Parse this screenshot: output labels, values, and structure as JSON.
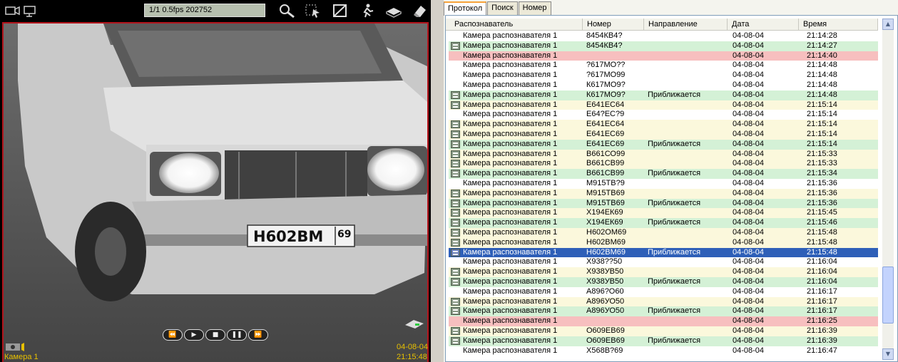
{
  "camera": {
    "stream_info": "1/1 0.5fps 202752",
    "label": "Камера 1",
    "date": "04-08-04",
    "time": "21:15:48",
    "plate_text": "Н602ВМ",
    "plate_region": "69",
    "transport": [
      "⏪",
      "▶",
      "■",
      "❚❚",
      "⏩"
    ]
  },
  "tabs": [
    {
      "label": "Протокол",
      "active": true
    },
    {
      "label": "Поиск",
      "active": false
    },
    {
      "label": "Номер",
      "active": false
    }
  ],
  "columns": [
    "Распознаватель",
    "Номер",
    "Направление",
    "Дата",
    "Время"
  ],
  "rows": [
    {
      "recognizer": "Камера распознавателя 1",
      "number": "8454КВ4?",
      "direction": "",
      "date": "04-08-04",
      "time": "21:14:28",
      "style": "white",
      "icon": false
    },
    {
      "recognizer": "Камера распознавателя 1",
      "number": "8454КВ4?",
      "direction": "",
      "date": "04-08-04",
      "time": "21:14:27",
      "style": "green",
      "icon": true
    },
    {
      "recognizer": "Камера распознавателя 1",
      "number": "",
      "direction": "",
      "date": "04-08-04",
      "time": "21:14:40",
      "style": "red",
      "icon": false
    },
    {
      "recognizer": "Камера распознавателя 1",
      "number": "?617МО??",
      "direction": "",
      "date": "04-08-04",
      "time": "21:14:48",
      "style": "white",
      "icon": false
    },
    {
      "recognizer": "Камера распознавателя 1",
      "number": "?617МО99",
      "direction": "",
      "date": "04-08-04",
      "time": "21:14:48",
      "style": "white",
      "icon": false
    },
    {
      "recognizer": "Камера распознавателя 1",
      "number": "К617МО9?",
      "direction": "",
      "date": "04-08-04",
      "time": "21:14:48",
      "style": "white",
      "icon": false
    },
    {
      "recognizer": "Камера распознавателя 1",
      "number": "К617МО9?",
      "direction": "Приближается",
      "date": "04-08-04",
      "time": "21:14:48",
      "style": "green",
      "icon": true
    },
    {
      "recognizer": "Камера распознавателя 1",
      "number": "Е641ЕС64",
      "direction": "",
      "date": "04-08-04",
      "time": "21:15:14",
      "style": "yellow",
      "icon": true
    },
    {
      "recognizer": "Камера распознавателя 1",
      "number": "Е64?ЕС?9",
      "direction": "",
      "date": "04-08-04",
      "time": "21:15:14",
      "style": "white",
      "icon": false
    },
    {
      "recognizer": "Камера распознавателя 1",
      "number": "Е641ЕС64",
      "direction": "",
      "date": "04-08-04",
      "time": "21:15:14",
      "style": "yellow",
      "icon": true
    },
    {
      "recognizer": "Камера распознавателя 1",
      "number": "Е641ЕС69",
      "direction": "",
      "date": "04-08-04",
      "time": "21:15:14",
      "style": "yellow",
      "icon": true
    },
    {
      "recognizer": "Камера распознавателя 1",
      "number": "Е641ЕС69",
      "direction": "Приближается",
      "date": "04-08-04",
      "time": "21:15:14",
      "style": "green",
      "icon": true
    },
    {
      "recognizer": "Камера распознавателя 1",
      "number": "В661СО99",
      "direction": "",
      "date": "04-08-04",
      "time": "21:15:33",
      "style": "yellow",
      "icon": true
    },
    {
      "recognizer": "Камера распознавателя 1",
      "number": "В661СВ99",
      "direction": "",
      "date": "04-08-04",
      "time": "21:15:33",
      "style": "yellow",
      "icon": true
    },
    {
      "recognizer": "Камера распознавателя 1",
      "number": "В661СВ99",
      "direction": "Приближается",
      "date": "04-08-04",
      "time": "21:15:34",
      "style": "green",
      "icon": true
    },
    {
      "recognizer": "Камера распознавателя 1",
      "number": "М915ТВ?9",
      "direction": "",
      "date": "04-08-04",
      "time": "21:15:36",
      "style": "white",
      "icon": false
    },
    {
      "recognizer": "Камера распознавателя 1",
      "number": "М915ТВ69",
      "direction": "",
      "date": "04-08-04",
      "time": "21:15:36",
      "style": "yellow",
      "icon": true
    },
    {
      "recognizer": "Камера распознавателя 1",
      "number": "М915ТВ69",
      "direction": "Приближается",
      "date": "04-08-04",
      "time": "21:15:36",
      "style": "green",
      "icon": true
    },
    {
      "recognizer": "Камера распознавателя 1",
      "number": "Х194ЕК69",
      "direction": "",
      "date": "04-08-04",
      "time": "21:15:45",
      "style": "yellow",
      "icon": true
    },
    {
      "recognizer": "Камера распознавателя 1",
      "number": "Х194ЕК69",
      "direction": "Приближается",
      "date": "04-08-04",
      "time": "21:15:46",
      "style": "green",
      "icon": true
    },
    {
      "recognizer": "Камера распознавателя 1",
      "number": "Н602ОМ69",
      "direction": "",
      "date": "04-08-04",
      "time": "21:15:48",
      "style": "yellow",
      "icon": true
    },
    {
      "recognizer": "Камера распознавателя 1",
      "number": "Н602ВМ69",
      "direction": "",
      "date": "04-08-04",
      "time": "21:15:48",
      "style": "yellow",
      "icon": true
    },
    {
      "recognizer": "Камера распознавателя 1",
      "number": "Н602ВМ69",
      "direction": "Приближается",
      "date": "04-08-04",
      "time": "21:15:48",
      "style": "selected",
      "icon": true
    },
    {
      "recognizer": "Камера распознавателя 1",
      "number": "Х938??50",
      "direction": "",
      "date": "04-08-04",
      "time": "21:16:04",
      "style": "white",
      "icon": false
    },
    {
      "recognizer": "Камера распознавателя 1",
      "number": "Х938УВ50",
      "direction": "",
      "date": "04-08-04",
      "time": "21:16:04",
      "style": "yellow",
      "icon": true
    },
    {
      "recognizer": "Камера распознавателя 1",
      "number": "Х938УВ50",
      "direction": "Приближается",
      "date": "04-08-04",
      "time": "21:16:04",
      "style": "green",
      "icon": true
    },
    {
      "recognizer": "Камера распознавателя 1",
      "number": "А896?О60",
      "direction": "",
      "date": "04-08-04",
      "time": "21:16:17",
      "style": "white",
      "icon": false
    },
    {
      "recognizer": "Камера распознавателя 1",
      "number": "А896УО50",
      "direction": "",
      "date": "04-08-04",
      "time": "21:16:17",
      "style": "yellow",
      "icon": true
    },
    {
      "recognizer": "Камера распознавателя 1",
      "number": "А896УО50",
      "direction": "Приближается",
      "date": "04-08-04",
      "time": "21:16:17",
      "style": "green",
      "icon": true
    },
    {
      "recognizer": "Камера распознавателя 1",
      "number": "",
      "direction": "",
      "date": "04-08-04",
      "time": "21:16:25",
      "style": "red",
      "icon": false
    },
    {
      "recognizer": "Камера распознавателя 1",
      "number": "О609ЕВ69",
      "direction": "",
      "date": "04-08-04",
      "time": "21:16:39",
      "style": "yellow",
      "icon": true
    },
    {
      "recognizer": "Камера распознавателя 1",
      "number": "О609ЕВ69",
      "direction": "Приближается",
      "date": "04-08-04",
      "time": "21:16:39",
      "style": "green",
      "icon": true
    },
    {
      "recognizer": "Камера распознавателя 1",
      "number": "Х568В?69",
      "direction": "",
      "date": "04-08-04",
      "time": "21:16:47",
      "style": "white",
      "icon": false
    }
  ],
  "scrollbar": {
    "up": "▲",
    "down": "▼"
  }
}
